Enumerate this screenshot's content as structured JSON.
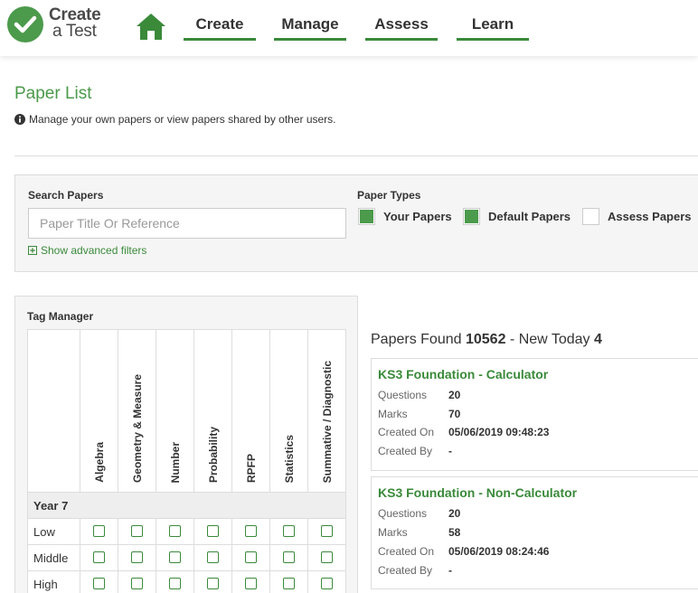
{
  "header": {
    "logo": {
      "line1": "Create",
      "line2": "a Test",
      "color": "#4c9a4c"
    },
    "nav": [
      {
        "label": "Create"
      },
      {
        "label": "Manage"
      },
      {
        "label": "Assess"
      },
      {
        "label": "Learn"
      }
    ]
  },
  "page": {
    "title": "Paper List",
    "info": "Manage your own papers or view papers shared by other users."
  },
  "search": {
    "label": "Search Papers",
    "placeholder": "Paper Title Or Reference",
    "advanced_filters": "Show advanced filters"
  },
  "paper_types": {
    "label": "Paper Types",
    "options": [
      {
        "label": "Your Papers",
        "checked": true
      },
      {
        "label": "Default Papers",
        "checked": true
      },
      {
        "label": "Assess Papers",
        "checked": false
      }
    ]
  },
  "tag_manager": {
    "title": "Tag Manager",
    "columns": [
      "Algebra",
      "Geometry & Measure",
      "Number",
      "Probability",
      "RPFP",
      "Statistics",
      "Summative / Diagnostic"
    ],
    "group": "Year 7",
    "rows": [
      "Low",
      "Middle",
      "High"
    ]
  },
  "results": {
    "found_label": "Papers Found",
    "found_count": "10562",
    "new_today_label": "- New Today",
    "new_today_count": "4",
    "meta_labels": {
      "questions": "Questions",
      "marks": "Marks",
      "created_on": "Created On",
      "created_by": "Created By"
    },
    "papers": [
      {
        "title": "KS3 Foundation - Calculator",
        "questions": "20",
        "marks": "70",
        "created_on": "05/06/2019 09:48:23",
        "created_by": "-"
      },
      {
        "title": "KS3 Foundation - Non-Calculator",
        "questions": "20",
        "marks": "58",
        "created_on": "05/06/2019 08:24:46",
        "created_by": "-"
      }
    ]
  },
  "colors": {
    "accent": "#3a8a3a",
    "title_green": "#4a9a4a",
    "panel_bg": "#f5f5f5"
  }
}
